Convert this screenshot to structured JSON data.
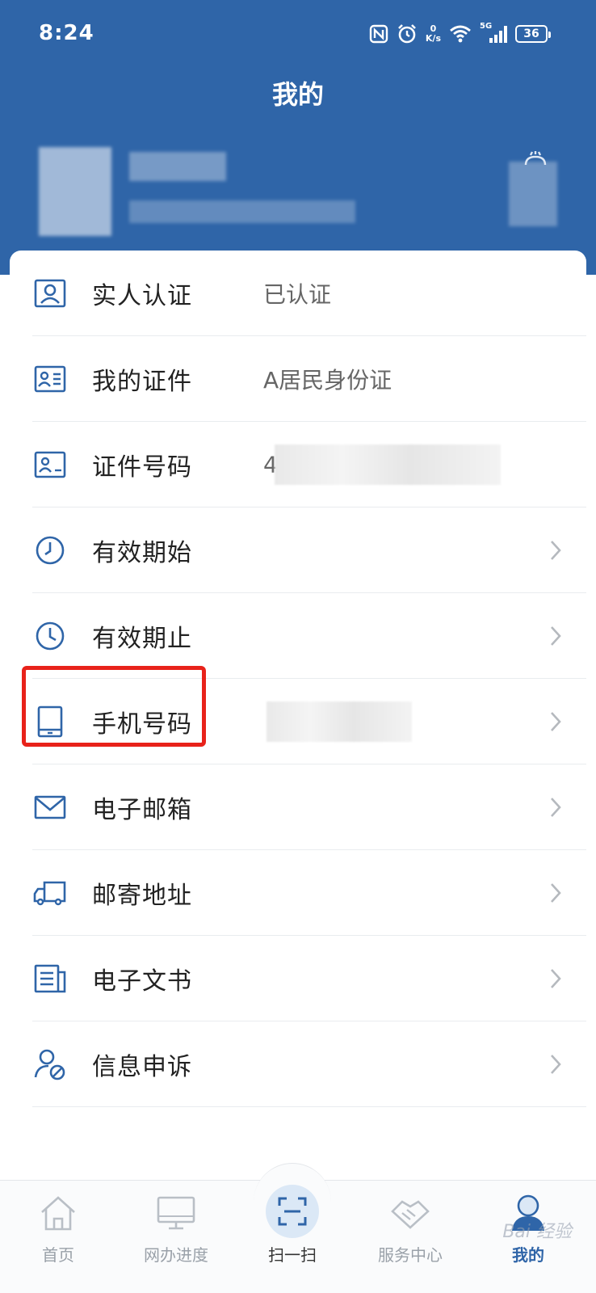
{
  "status_bar": {
    "time": "8:24",
    "network_speed_value": "0",
    "network_speed_unit": "K/s",
    "network_type": "5G",
    "battery": "36"
  },
  "header": {
    "title": "我的"
  },
  "menu": {
    "items": [
      {
        "label": "实人认证",
        "value": "已认证",
        "icon": "id-person-icon",
        "chevron": false
      },
      {
        "label": "我的证件",
        "value": "A居民身份证",
        "icon": "id-card-icon",
        "chevron": false
      },
      {
        "label": "证件号码",
        "value": "4",
        "icon": "id-number-icon",
        "chevron": false
      },
      {
        "label": "有效期始",
        "value": "",
        "icon": "clock-icon",
        "chevron": true
      },
      {
        "label": "有效期止",
        "value": "",
        "icon": "clock-icon",
        "chevron": true
      },
      {
        "label": "手机号码",
        "value": "",
        "icon": "phone-icon",
        "chevron": true
      },
      {
        "label": "电子邮箱",
        "value": "",
        "icon": "mail-icon",
        "chevron": true
      },
      {
        "label": "邮寄地址",
        "value": "",
        "icon": "truck-icon",
        "chevron": true
      },
      {
        "label": "电子文书",
        "value": "",
        "icon": "document-icon",
        "chevron": true
      },
      {
        "label": "信息申诉",
        "value": "",
        "icon": "user-forbid-icon",
        "chevron": true
      }
    ]
  },
  "tabbar": {
    "tabs": [
      {
        "label": "首页",
        "icon": "home-icon"
      },
      {
        "label": "网办进度",
        "icon": "monitor-icon"
      },
      {
        "label": "扫一扫",
        "icon": "scan-icon"
      },
      {
        "label": "服务中心",
        "icon": "handshake-icon"
      },
      {
        "label": "我的",
        "icon": "user-icon"
      }
    ],
    "active": "我的"
  },
  "watermark": "Bai 经验",
  "colors": {
    "primary": "#2f65a8",
    "highlight": "#e8221a",
    "text": "#222222",
    "secondary_text": "#666666"
  }
}
